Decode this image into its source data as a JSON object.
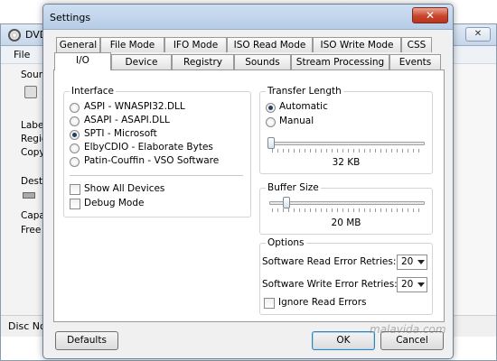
{
  "background_window": {
    "title": "DVD",
    "close_glyph": "✕",
    "menu_file": "File",
    "left_labels": [
      "Sourc",
      "Label",
      "Regio",
      "Copy",
      "Desti",
      "Capa",
      "Free"
    ],
    "status_text": "Disc No"
  },
  "dialog": {
    "title": "Settings",
    "close_glyph": "✕",
    "tabs_row1": [
      "General",
      "File Mode",
      "IFO Mode",
      "ISO Read Mode",
      "ISO Write Mode",
      "CSS"
    ],
    "tabs_row2": [
      "I/O",
      "Device",
      "Registry",
      "Sounds",
      "Stream Processing",
      "Events"
    ],
    "active_tab": "I/O",
    "interface": {
      "legend": "Interface",
      "options": [
        "ASPI - WNASPI32.DLL",
        "ASAPI - ASAPI.DLL",
        "SPTI - Microsoft",
        "ElbyCDIO - Elaborate Bytes",
        "Patin-Couffin - VSO Software"
      ],
      "selected": "SPTI - Microsoft",
      "show_all_devices": "Show All Devices",
      "debug_mode": "Debug Mode"
    },
    "transfer_length": {
      "legend": "Transfer Length",
      "automatic": "Automatic",
      "manual": "Manual",
      "selected": "Automatic",
      "value": "32 KB",
      "slider_level": 0
    },
    "buffer_size": {
      "legend": "Buffer Size",
      "value": "20 MB",
      "slider_level": 0.1
    },
    "options": {
      "legend": "Options",
      "read_retries_label": "Software Read Error Retries:",
      "read_retries_value": "20",
      "write_retries_label": "Software Write Error Retries:",
      "write_retries_value": "20",
      "ignore_read_errors": "Ignore Read Errors"
    },
    "buttons": {
      "defaults": "Defaults",
      "ok": "OK",
      "cancel": "Cancel"
    }
  },
  "watermark": "malavida.com"
}
